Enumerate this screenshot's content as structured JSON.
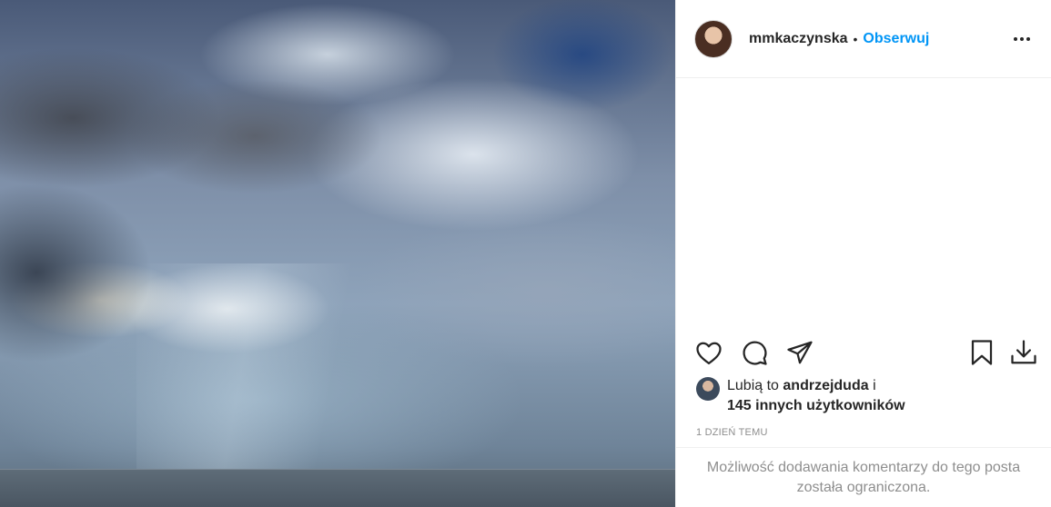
{
  "post": {
    "username": "mmkaczynska",
    "separator": "•",
    "follow_label": "Obserwuj",
    "more_icon": "more-horizontal-icon",
    "likes_prefix": "Lubią to",
    "likes_user": "andrzejduda",
    "likes_connector": "i",
    "likes_count_text": "145 innych użytkowników",
    "timestamp": "1 DZIEŃ TEMU",
    "comments_disabled": "Możliwość dodawania komentarzy do tego posta została ograniczona."
  },
  "actions": {
    "like_icon": "heart-icon",
    "comment_icon": "comment-icon",
    "share_icon": "share-icon",
    "save_icon": "bookmark-icon",
    "download_icon": "download-icon"
  },
  "colors": {
    "link": "#0095f6",
    "text": "#262626",
    "muted": "#8e8e8e",
    "border": "#efefef"
  }
}
